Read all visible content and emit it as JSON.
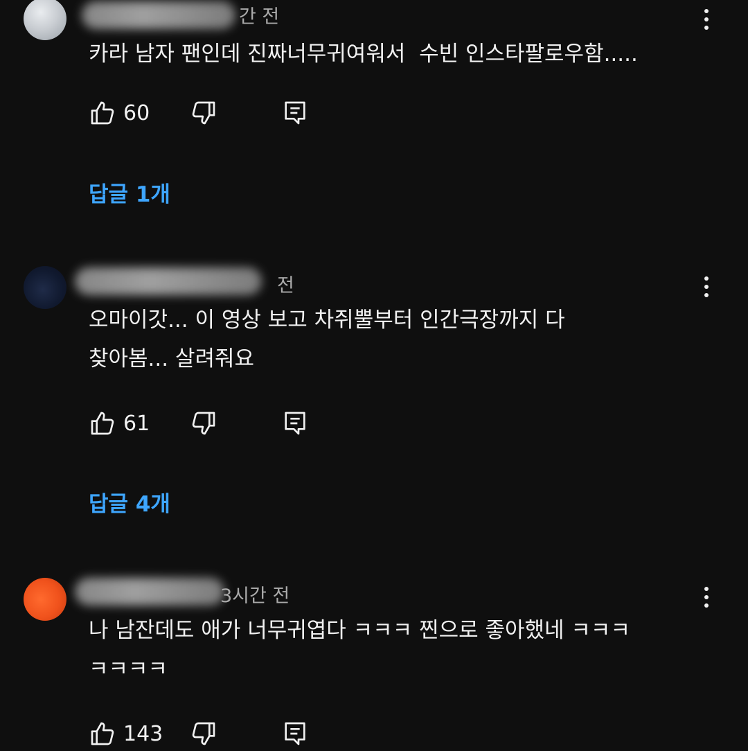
{
  "comments": [
    {
      "time_suffix": "간 전",
      "text": "카라 남자 팬인데 진짜너무귀여워서  수빈 인스타팔로우함.....",
      "likes": "60",
      "replies_label": "답글 1개"
    },
    {
      "time_suffix": "전",
      "text": "오마이갓... 이 영상 보고 차쥐뿔부터 인간극장까지 다\n찾아봄... 살려줘요",
      "likes": "61",
      "replies_label": "답글 4개"
    },
    {
      "time_suffix": "3시간 전",
      "text": "나 남잔데도 애가 너무귀엽다 ㅋㅋㅋ 찐으로 좋아했네 ㅋㅋㅋ\nㅋㅋㅋㅋ",
      "likes": "143"
    }
  ],
  "icons": {
    "like": "thumbs-up-icon",
    "dislike": "thumbs-down-icon",
    "reply": "reply-comment-icon",
    "more": "more-vert-icon"
  },
  "colors": {
    "background": "#0f0f0f",
    "text": "#f1f1f1",
    "secondary_text": "#aaaaaa",
    "link": "#3ea6ff"
  }
}
